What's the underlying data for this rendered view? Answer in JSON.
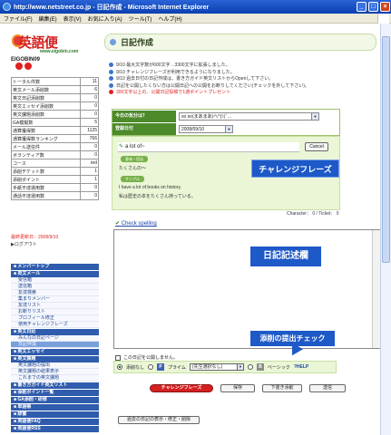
{
  "window": {
    "title": "http://www.netstreet.co.jp - 日記作成 - Microsoft Internet Explorer",
    "minimize": "_",
    "maximize": "□",
    "close": "×"
  },
  "menu": [
    "ファイル(F)",
    "編集(E)",
    "表示(V)",
    "お気に入り(A)",
    "ツール(T)",
    "ヘルプ(H)"
  ],
  "sidebar": {
    "logo": "英語便",
    "logo_sub": "www.eigobin.com",
    "user": "EIGOBIN09",
    "stats": [
      {
        "label": "トータル件数",
        "value": "11"
      },
      {
        "label": "英文メール添削数",
        "value": "6"
      },
      {
        "label": "英文日記添削数",
        "value": "0"
      },
      {
        "label": "英文エッセイ添削数",
        "value": "0"
      },
      {
        "label": "英文課題添削数",
        "value": "0"
      },
      {
        "label": "GA模擬数",
        "value": "5"
      },
      {
        "label": "通算獲得数",
        "value": "1125"
      },
      {
        "label": "通算獲得数ランキング",
        "value": "766"
      },
      {
        "label": "メール送信件",
        "value": "0"
      },
      {
        "label": "ボランティア数",
        "value": "0"
      },
      {
        "label": "コース",
        "value": "red"
      },
      {
        "label": "添削チケット数",
        "value": "1"
      },
      {
        "label": "添削ポイント",
        "value": "1"
      },
      {
        "label": "手紙不達運用数",
        "value": "0"
      },
      {
        "label": "通話不達運用数",
        "value": "0"
      }
    ],
    "updated": "最終更新日：2008/9/10",
    "logout": "▶ログアウト",
    "nav": [
      {
        "type": "sec",
        "label": "■ メンバートップ"
      },
      {
        "type": "sec",
        "label": "■ 英文メール"
      },
      {
        "type": "item",
        "label": "受信箱"
      },
      {
        "type": "item",
        "label": "送信箱"
      },
      {
        "type": "item",
        "label": "友達検索"
      },
      {
        "type": "item",
        "label": "集まりメンバー"
      },
      {
        "type": "item",
        "label": "友達リスト"
      },
      {
        "type": "item",
        "label": "お断りリスト"
      },
      {
        "type": "item",
        "label": "プロフィール修正"
      },
      {
        "type": "item",
        "label": "使用チャレンジフレーズ"
      },
      {
        "type": "sec",
        "label": "■ 英文日記"
      },
      {
        "type": "item",
        "label": "みんなの日記ページ"
      },
      {
        "type": "item",
        "label": "日記作成"
      },
      {
        "type": "sec",
        "label": "■ 英文エッセイ"
      },
      {
        "type": "sec",
        "label": "■ 英文課題"
      },
      {
        "type": "item",
        "label": "英文課題の提出"
      },
      {
        "type": "item",
        "label": "英文課題の結果表示"
      },
      {
        "type": "item",
        "label": "これまでの英文課題"
      },
      {
        "type": "sec",
        "label": "■ 書き方ガイド英文リスト"
      },
      {
        "type": "sec",
        "label": "■ 添削ポイント一覧"
      },
      {
        "type": "sec",
        "label": "■ GA添削・研修"
      },
      {
        "type": "sec",
        "label": "■ 単語帳"
      },
      {
        "type": "sec",
        "label": "■ 辞書"
      },
      {
        "type": "sec",
        "label": "■ 英語便FAQ"
      },
      {
        "type": "sec",
        "label": "■ 英語便RSS"
      }
    ]
  },
  "header": {
    "title": "日記作成"
  },
  "notices": [
    {
      "text": "9/10 最大文字数が600文字→3300文字に拡張しました。",
      "red": false
    },
    {
      "text": "9/10 チャレンジフレーズが利用できるようになりました。",
      "red": false
    },
    {
      "text": "9/10 過去日付の日記作成は、書き方ガイド英文リストからOpenして下さい。",
      "red": false
    },
    {
      "text": "日記を公開したくない方は公開日記への公開をお断りしてください(チェックを外して下さい)。",
      "red": false
    },
    {
      "text": "300文字以上の、公開日記投稿で1通ポイントプレゼント",
      "red": true
    }
  ],
  "form": {
    "mood_label": "今日の気分は？",
    "mood_value": "so so(まあまあ)ヘ^(ｼ)ﾟ...",
    "date_label": "登録日付",
    "date_value": "2008/09/10",
    "phrase": "a lot of~",
    "cancel": "Cancel",
    "tag1": "意味・用法",
    "meaning": "たくさんの〜",
    "tag2": "サンプル",
    "ex_en": "I have a lot of books on history.",
    "ex_ja": "私は歴史の本をたくさん持っている。",
    "char_label": "Character：",
    "char_value": "0",
    "ticket_label": "/ Ticket：",
    "ticket_value": "0",
    "check_spelling": "Check spelling",
    "no_open": "この日記を公開しません。",
    "no_corr": "添削なし",
    "puraim": "プライム",
    "teacher": "(先生選択なし)",
    "basic": "ベーシック",
    "help": "HELP",
    "btn_challenge": "チャレンジフレーズ",
    "btn_save": "保存",
    "btn_draft": "下書き添削",
    "btn_send": "送信",
    "past": "過去の日記の表示・修正・削除"
  },
  "callouts": {
    "c1": "チャレンジフレーズ",
    "c2": "日記記述欄",
    "c3": "添削の提出チェック"
  }
}
